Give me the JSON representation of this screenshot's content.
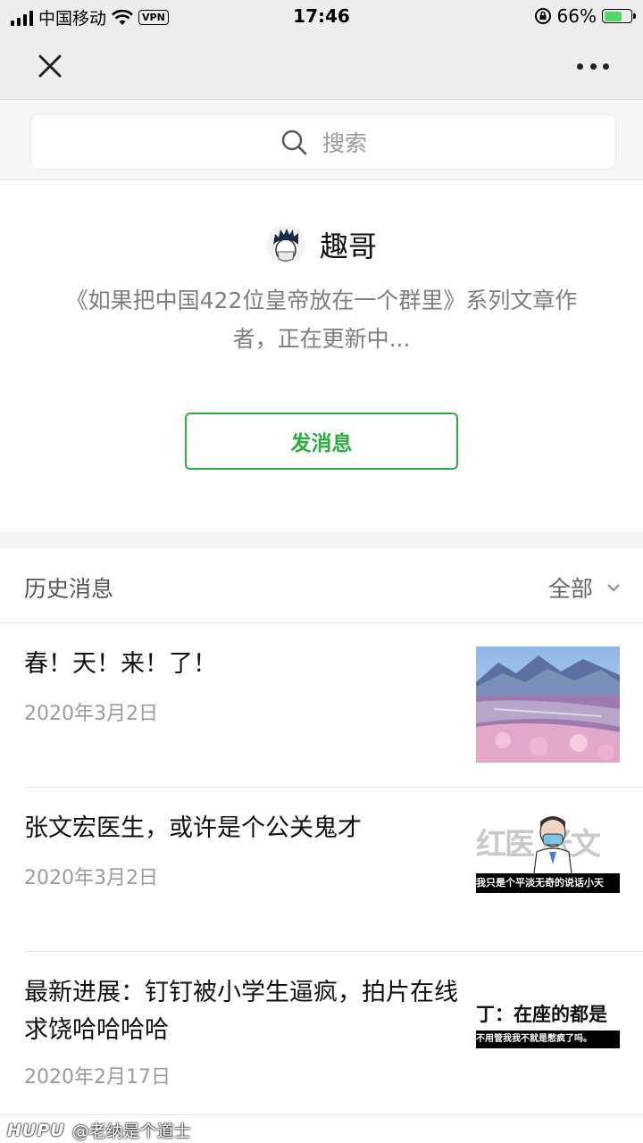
{
  "status_bar": {
    "carrier": "中国移动",
    "vpn": "VPN",
    "time": "17:46",
    "battery_percent": "66%",
    "battery_level": 0.66
  },
  "search": {
    "placeholder": "搜索"
  },
  "profile": {
    "name": "趣哥",
    "bio": "《如果把中国422位皇帝放在一个群里》系列文章作者，正在更新中...",
    "send_message_label": "发消息"
  },
  "history": {
    "title": "历史消息",
    "filter_label": "全部"
  },
  "articles": [
    {
      "title": "春！天！来！了！",
      "date": "2020年3月2日"
    },
    {
      "title": "张文宏医生，或许是个公关鬼才",
      "date": "2020年3月2日",
      "thumb_text_big": "红医 张文",
      "thumb_text_small": "我只是个平淡无奇的说话小天"
    },
    {
      "title": "最新进展：钉钉被小学生逼疯，拍片在线求饶哈哈哈哈",
      "date": "2020年2月17日",
      "thumb_text_big": "丁：在座的都是",
      "thumb_text_small": "不用管我我不就是憋疯了吗。"
    }
  ],
  "watermark": {
    "brand": "HUPU",
    "user": "@老纳是个道士"
  },
  "colors": {
    "accent": "#2bae3e",
    "nav_bg": "#ededed"
  }
}
